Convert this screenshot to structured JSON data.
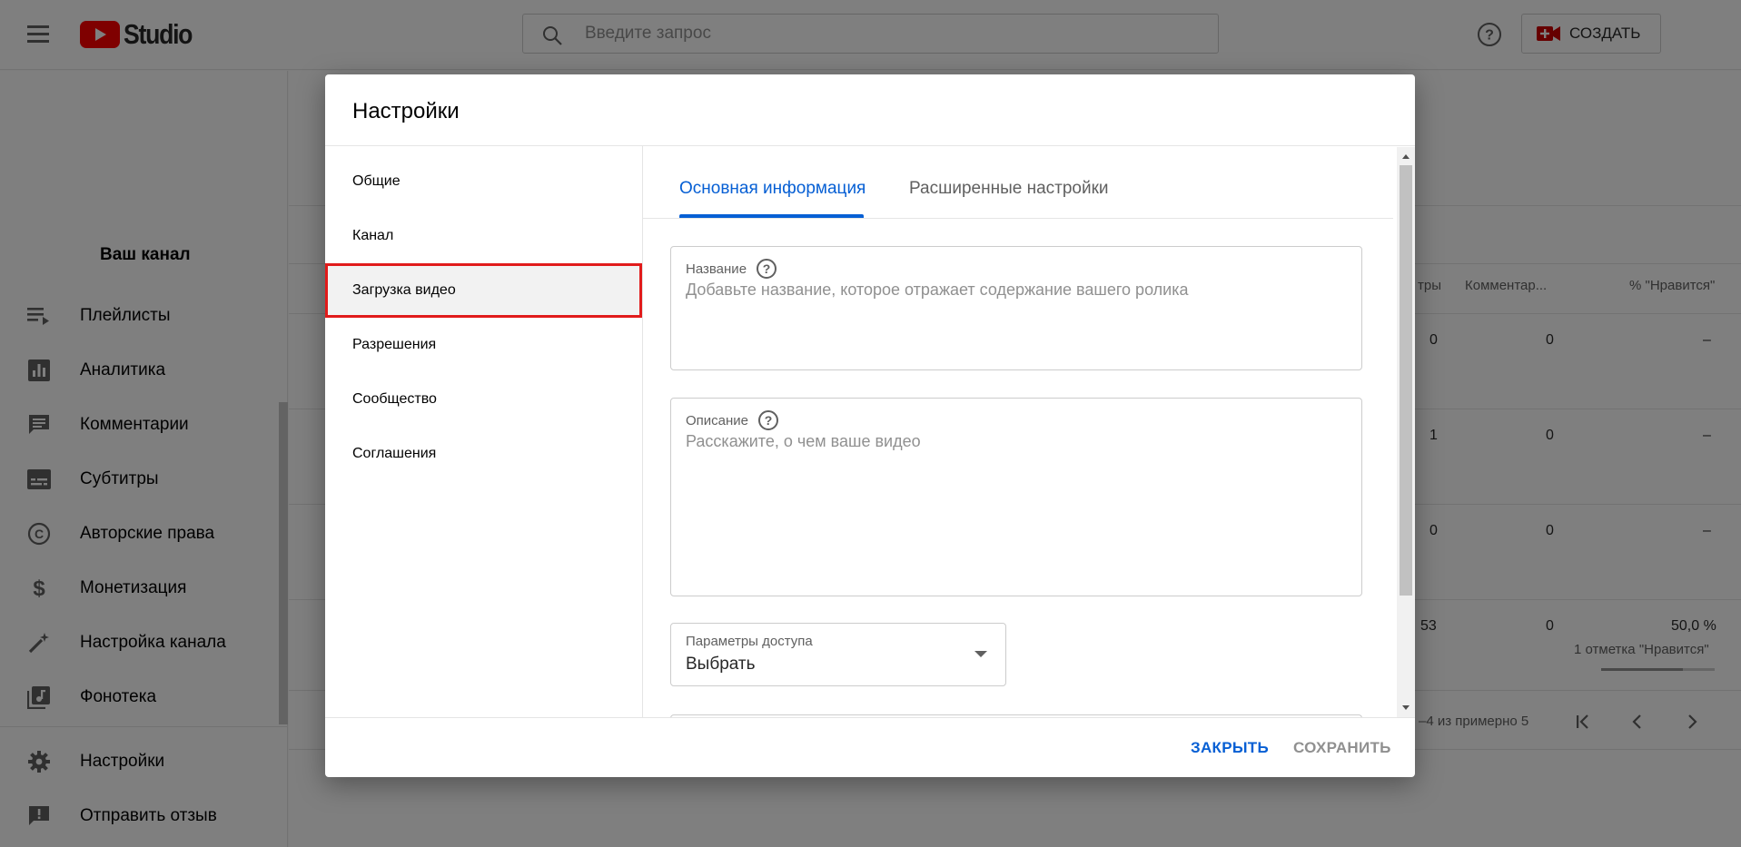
{
  "app": {
    "logo_text": "Studio",
    "search_placeholder": "Введите запрос",
    "create_label": "СОЗДАТЬ"
  },
  "sidebar": {
    "channel_title": "Ваш канал",
    "items": [
      {
        "label": "Плейлисты",
        "icon": "playlist-icon"
      },
      {
        "label": "Аналитика",
        "icon": "analytics-icon"
      },
      {
        "label": "Комментарии",
        "icon": "comments-icon"
      },
      {
        "label": "Субтитры",
        "icon": "subtitles-icon"
      },
      {
        "label": "Авторские права",
        "icon": "copyright-icon"
      },
      {
        "label": "Монетизация",
        "icon": "dollar-icon"
      },
      {
        "label": "Настройка канала",
        "icon": "magic-wand-icon"
      },
      {
        "label": "Фонотека",
        "icon": "audio-library-icon"
      }
    ],
    "bottom_items": [
      {
        "label": "Настройки",
        "icon": "gear-icon"
      },
      {
        "label": "Отправить отзыв",
        "icon": "feedback-icon"
      }
    ]
  },
  "table": {
    "headers": [
      "тры",
      "Комментар...",
      "% \"Нравится\""
    ],
    "rows": [
      {
        "views": "0",
        "comments": "0",
        "likes": "–"
      },
      {
        "views": "1",
        "comments": "0",
        "likes": "–"
      },
      {
        "views": "0",
        "comments": "0",
        "likes": "–"
      },
      {
        "views": "53",
        "comments": "0",
        "likes": "50,0 %",
        "likes_sub": "1 отметка \"Нравится\""
      }
    ],
    "pagination": "–4 из примерно 5"
  },
  "dialog": {
    "title": "Настройки",
    "nav": [
      {
        "label": "Общие"
      },
      {
        "label": "Канал"
      },
      {
        "label": "Загрузка видео",
        "active": true
      },
      {
        "label": "Разрешения"
      },
      {
        "label": "Сообщество"
      },
      {
        "label": "Соглашения"
      }
    ],
    "tabs": [
      {
        "label": "Основная информация",
        "active": true
      },
      {
        "label": "Расширенные настройки"
      }
    ],
    "fields": {
      "title": {
        "label": "Название",
        "placeholder": "Добавьте название, которое отражает содержание вашего ролика"
      },
      "description": {
        "label": "Описание",
        "placeholder": "Расскажите, о чем ваше видео"
      },
      "visibility": {
        "label": "Параметры доступа",
        "value": "Выбрать"
      }
    },
    "buttons": {
      "close": "ЗАКРЫТЬ",
      "save": "СОХРАНИТЬ"
    }
  },
  "colors": {
    "accent_blue": "#065fd4",
    "highlight_red": "#e11b1b",
    "youtube_red": "#ff0000"
  }
}
